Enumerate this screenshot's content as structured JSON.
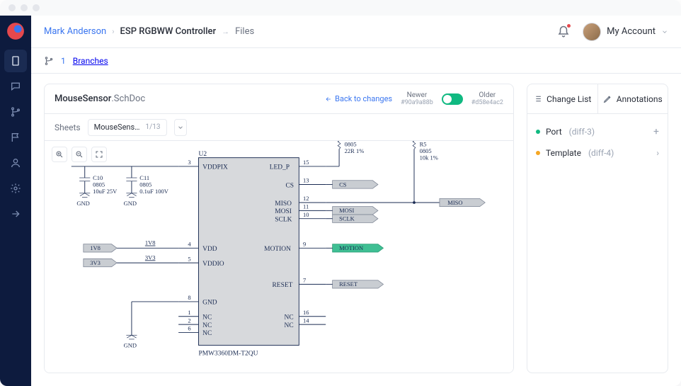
{
  "breadcrumb": {
    "user": "Mark Anderson",
    "project": "ESP RGBWW Controller",
    "section": "Files"
  },
  "account_label": "My Account",
  "subbar": {
    "count": "1",
    "label": "Branches"
  },
  "doc": {
    "title_base": "MouseSensor",
    "title_ext": ".SchDoc",
    "back_label": "Back to changes",
    "newer_label": "Newer",
    "newer_hash": "#90a9a88b",
    "older_label": "Older",
    "older_hash": "#d58e4ac2"
  },
  "sheets": {
    "label": "Sheets",
    "sheet_name": "MouseSens…",
    "page": "1/13"
  },
  "right_panel": {
    "tab1": "Change List",
    "tab2": "Annotations",
    "items": [
      {
        "name": "Port",
        "suffix": "(diff-3)",
        "color": "green",
        "action": "plus"
      },
      {
        "name": "Template",
        "suffix": "(diff-4)",
        "color": "amber",
        "action": "chev"
      }
    ]
  },
  "schematic": {
    "chip_ref": "U2",
    "chip_part": "PMW3360DM-T2QU",
    "left_pins": [
      {
        "num": "3",
        "label": "VDDPIX"
      },
      {
        "num": "4",
        "label": "VDD"
      },
      {
        "num": "5",
        "label": "VDDIO"
      },
      {
        "num": "8",
        "label": "GND"
      },
      {
        "num": "1",
        "label": "NC"
      },
      {
        "num": "2",
        "label": "NC"
      },
      {
        "num": "6",
        "label": "NC"
      }
    ],
    "right_pins": [
      {
        "num": "15",
        "label": "LED_P"
      },
      {
        "num": "13",
        "label": "CS"
      },
      {
        "num": "12",
        "label": "MISO"
      },
      {
        "num": "11",
        "label": "MOSI"
      },
      {
        "num": "10",
        "label": "SCLK"
      },
      {
        "num": "9",
        "label": "MOTION"
      },
      {
        "num": "7",
        "label": "RESET"
      },
      {
        "num": "16",
        "label": "NC"
      },
      {
        "num": "14",
        "label": "NC"
      }
    ],
    "caps": [
      {
        "ref": "C10",
        "pkg": "0805",
        "value": "10uF 25V",
        "gnd": "GND"
      },
      {
        "ref": "C11",
        "pkg": "0805",
        "value": "0.1uF 100V",
        "gnd": "GND"
      }
    ],
    "resistors": [
      {
        "pkg": "0805",
        "value": "22R 1%"
      },
      {
        "ref": "R5",
        "pkg": "0805",
        "value": "10k 1%"
      }
    ],
    "nets": {
      "cs": "CS",
      "mosi": "MOSI",
      "sclk": "SCLK",
      "miso": "MISO",
      "motion": "MOTION",
      "reset": "RESET",
      "v1_8": "1V8",
      "v3_3": "3V3",
      "v1_8_lbl": "1V8",
      "v3_3_lbl": "3V3",
      "gnd": "GND"
    }
  }
}
